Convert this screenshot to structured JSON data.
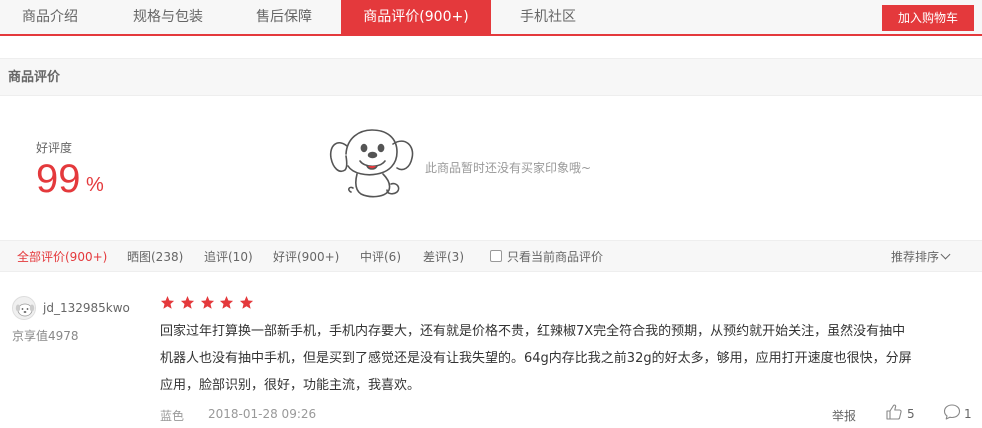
{
  "tabs": {
    "intro": "商品介绍",
    "specs": "规格与包装",
    "service": "售后保障",
    "reviews": "商品评价(900+)",
    "community": "手机社区"
  },
  "cart_button": "加入购物车",
  "section_title": "商品评价",
  "rating": {
    "label": "好评度",
    "value": "99",
    "unit": "%"
  },
  "empty_impressions": "此商品暂时还没有买家印象哦~",
  "filters": {
    "all": "全部评价(900+)",
    "photos": "晒图(238)",
    "followup": "追评(10)",
    "good": "好评(900+)",
    "medium": "中评(6)",
    "bad": "差评(3)",
    "current_only": "只看当前商品评价",
    "sort": "推荐排序"
  },
  "review": {
    "username": "jd_132985kwo",
    "user_value": "京享值4978",
    "stars": 5,
    "line1": "回家过年打算换一部新手机，手机内存要大，还有就是价格不贵，红辣椒7X完全符合我的预期，从预约就开始关注，虽然没有抽中",
    "line2": "机器人也没有抽中手机，但是买到了感觉还是没有让我失望的。64g内存比我之前32g的好太多，够用，应用打开速度也很快，分屏",
    "line3": "应用，脸部识别，很好，功能主流，我喜欢。",
    "color": "蓝色",
    "date": "2018-01-28 09:26",
    "report": "举报",
    "likes": "5",
    "replies": "1"
  },
  "colors": {
    "accent": "#e4393c",
    "bar_bg": "#f7f7f7"
  }
}
